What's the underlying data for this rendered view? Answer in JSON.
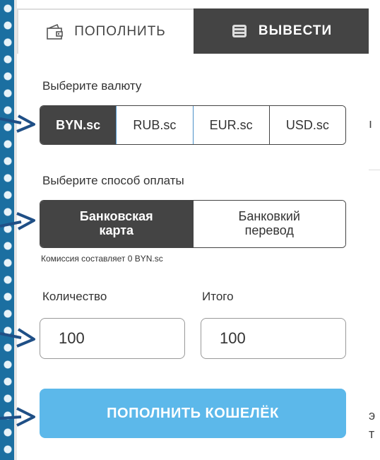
{
  "tabs": [
    {
      "label": "ПОПОЛНИТЬ",
      "icon": "wallet-icon",
      "active": true
    },
    {
      "label": "ВЫВЕСТИ",
      "icon": "cash-icon",
      "active": false
    }
  ],
  "currency_section": {
    "label": "Выберите валюту",
    "options": [
      "BYN.sc",
      "RUB.sc",
      "EUR.sc",
      "USD.sc"
    ],
    "selected": "BYN.sc"
  },
  "payment_section": {
    "label": "Выберите способ оплаты",
    "options": [
      {
        "line1": "Банковская",
        "line2": "карта"
      },
      {
        "line1": "Банковкий",
        "line2": "перевод"
      }
    ],
    "selected_index": 0,
    "commission": "Комиссия составляет 0 BYN.sc"
  },
  "amount": {
    "label": "Количество",
    "value": "100"
  },
  "total": {
    "label": "Итого",
    "value": "100"
  },
  "submit_label": "ПОПОЛНИТЬ КОШЕЛЁК",
  "background_right": {
    "glyph1": "ı",
    "glyph2": "э",
    "glyph3": "т"
  },
  "colors": {
    "accent": "#5cb8ea",
    "dark": "#444444",
    "arrow": "#1f4f86"
  }
}
